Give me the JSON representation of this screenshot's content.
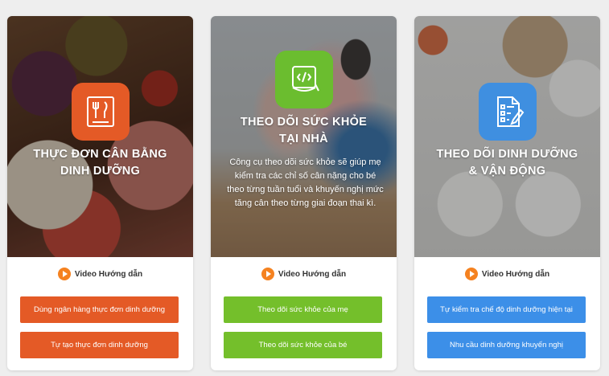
{
  "cards": [
    {
      "icon": "menu-card-icon",
      "title_line1": "THỰC ĐƠN CÂN BẰNG",
      "title_line2": "DINH DƯỠNG",
      "video_label": "Video Hướng dẫn",
      "buttons": [
        "Dùng ngân hàng thực đơn dinh dưỡng",
        "Tự tạo thực đơn dinh dưỡng"
      ],
      "accent": "#e45a26"
    },
    {
      "icon": "measuring-tape-icon",
      "title_line1": "THEO DÕI SỨC KHỎE",
      "title_line2": "TẠI NHÀ",
      "description": "Công cụ theo dõi sức khỏe sẽ giúp mẹ kiểm tra các chỉ số cân nặng cho bé theo từng tuần tuổi và khuyến nghị mức tăng cân theo từng giai đoạn thai kì.",
      "video_label": "Video Hướng dẫn",
      "buttons": [
        "Theo dõi sức khỏe của mẹ",
        "Theo dõi sức khỏe của bé"
      ],
      "accent": "#6bbd2f"
    },
    {
      "icon": "checklist-icon",
      "title_line1": "THEO DÕI DINH DƯỠNG",
      "title_line2": "& VẬN ĐỘNG",
      "video_label": "Video Hướng dẫn",
      "buttons": [
        "Tự kiểm tra chế độ dinh dưỡng hiện tại",
        "Nhu cầu dinh dưỡng khuyến nghị"
      ],
      "accent": "#3f8fe0"
    }
  ]
}
